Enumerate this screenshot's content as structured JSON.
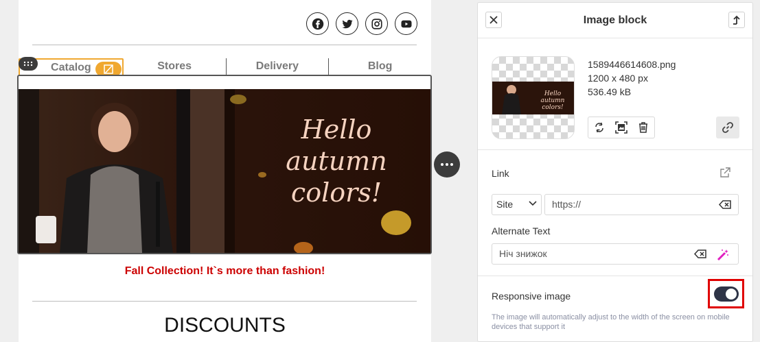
{
  "email": {
    "menu": [
      "Catalog",
      "Stores",
      "Delivery",
      "Blog"
    ],
    "banner_text": "Hello autumn colors!",
    "caption": "Fall Collection! It`s more than fashion!",
    "heading": "DISCOUNTS",
    "social_icons": [
      "facebook-icon",
      "twitter-icon",
      "instagram-icon",
      "youtube-icon"
    ]
  },
  "panel": {
    "title": "Image block",
    "file_name": "1589446614608.png",
    "dimensions": "1200 x 480 px",
    "file_size": "536.49 kB",
    "link_label": "Link",
    "link_type": "Site",
    "link_placeholder": "https://",
    "alt_label": "Alternate Text",
    "alt_value": "Ніч знижок",
    "responsive_label": "Responsive image",
    "responsive_hint": "The image will automatically adjust to the width of the screen on mobile devices that support it",
    "responsive_enabled": true
  },
  "colors": {
    "accent": "#f0a830",
    "caption_red": "#cc0000",
    "toggle_on": "#2e3447",
    "highlight": "#e00000"
  }
}
